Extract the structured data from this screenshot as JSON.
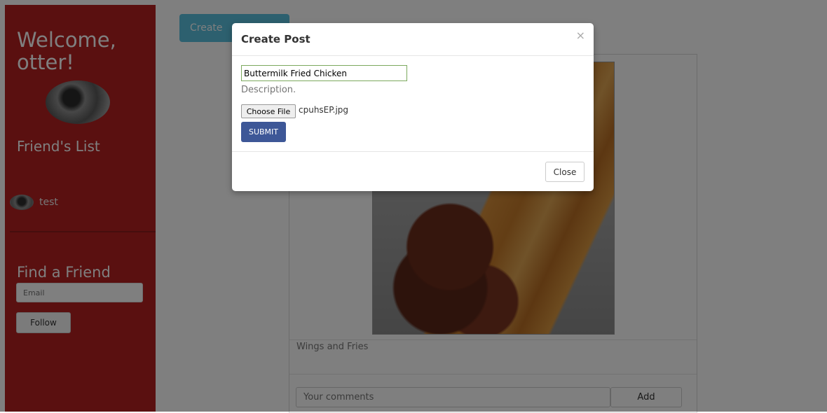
{
  "sidebar": {
    "welcome_line1": "Welcome,",
    "welcome_line2": "otter!",
    "friends_title": "Friend's List",
    "friends": [
      {
        "name": "test"
      }
    ],
    "find_title": "Find a Friend",
    "email_placeholder": "Email",
    "follow_label": "Follow"
  },
  "main": {
    "create_post_label": "Create",
    "post": {
      "caption": "Wings and Fries",
      "comment_placeholder": "Your comments",
      "add_label": "Add"
    }
  },
  "modal": {
    "title": "Create Post",
    "close_x": "×",
    "title_value": "Buttermilk Fried Chicken",
    "description_placeholder": "Description.",
    "choose_file_label": "Choose File",
    "file_name": "cpuhsEP.jpg",
    "submit_label": "SUBMIT",
    "close_label": "Close"
  },
  "colors": {
    "sidebar": "#b52121",
    "create_button": "#5bc0de",
    "submit_button": "#3d5797"
  }
}
